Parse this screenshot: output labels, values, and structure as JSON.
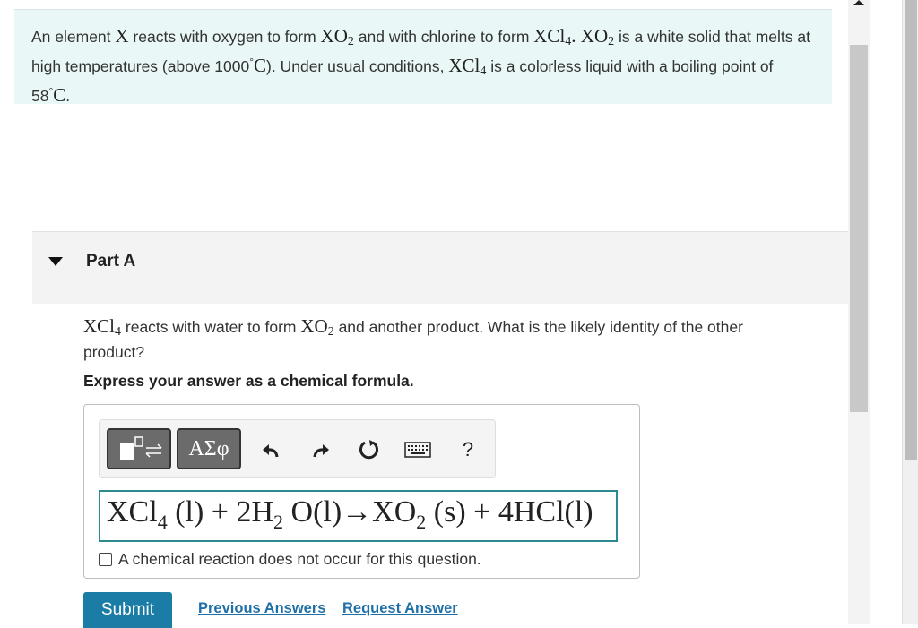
{
  "intro": {
    "p1": "An element ",
    "x1": "X",
    "p2": " reacts with oxygen to form ",
    "xo2_a": "XO",
    "p3": " and with chlorine to form ",
    "xcl4_a": "XCl",
    "p4": ". ",
    "xo2_b": "XO",
    "p5": " is a white solid that melts at high temperatures (above 1000",
    "deg1": "°",
    "c1": "C",
    "p6": "). Under usual conditions, ",
    "xcl4_b": "XCl",
    "p7": " is a colorless liquid with a boiling point of 58",
    "deg2": "°",
    "c2": "C",
    "p8": ".",
    "sub2": "2",
    "sub4": "4"
  },
  "part": {
    "title": "Part A"
  },
  "question": {
    "xcl4": "XCl",
    "sub4": "4",
    "p1": " reacts with water to form ",
    "xo2": "XO",
    "sub2": "2",
    "p2": " and another product. What is the likely identity of the other product?"
  },
  "instruction": "Express your answer as a chemical formula.",
  "toolbar": {
    "greek_label": "ΑΣφ",
    "help_label": "?",
    "icons": [
      "templates-icon",
      "greek-symbols-icon",
      "undo-icon",
      "redo-icon",
      "reset-icon",
      "keyboard-icon",
      "help-icon"
    ]
  },
  "formula": {
    "a": "XCl",
    "s1": "4",
    "b": " (l) + 2H",
    "s2": "2",
    "c": " O(l)→XO",
    "s3": "2",
    "d": " (s) + 4HCl(l)"
  },
  "no_reaction_label": "A chemical reaction does not occur for this question.",
  "actions": {
    "submit": "Submit",
    "previous": "Previous Answers",
    "request": "Request Answer"
  },
  "colors": {
    "intro_bg": "#e9f7f7",
    "submit_bg": "#1b7da6",
    "link": "#1f6fa8",
    "field_border": "#2a8a8f"
  }
}
